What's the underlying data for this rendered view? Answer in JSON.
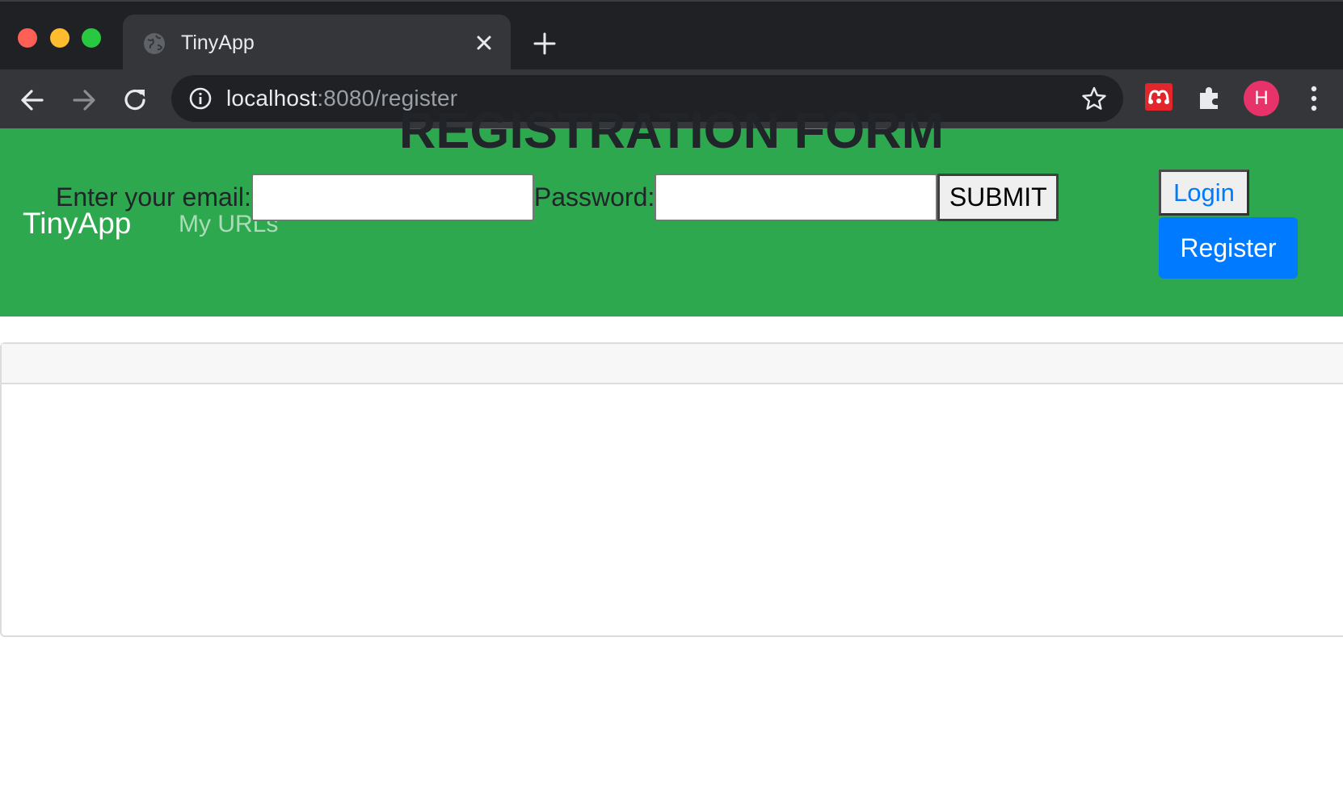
{
  "browser": {
    "tab_title": "TinyApp",
    "url_host": "localhost",
    "url_path": ":8080/register",
    "avatar_initial": "H",
    "icons": [
      "globe-icon",
      "close-icon",
      "plus-icon",
      "back-arrow-icon",
      "forward-arrow-icon",
      "reload-icon",
      "info-icon",
      "star-icon",
      "mendeley-extension-icon",
      "puzzle-icon",
      "kebab-menu-icon"
    ]
  },
  "navbar": {
    "brand": "TinyApp",
    "my_urls": "My URLs",
    "login_label": "Login",
    "register_label": "Register",
    "background_color": "#2ea84e",
    "register_color": "#007bff"
  },
  "form": {
    "title": "REGISTRATION FORM",
    "email_label": "Enter your email:",
    "email_value": "",
    "password_label": "Password:",
    "password_value": "",
    "submit_label": "SUBMIT"
  }
}
